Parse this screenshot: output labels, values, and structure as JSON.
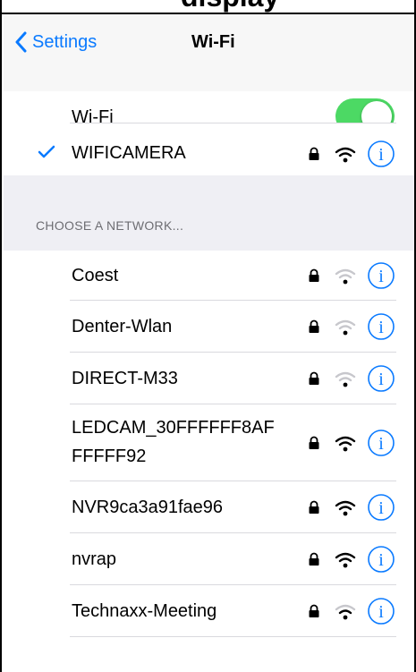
{
  "caption_fragment": "display",
  "nav": {
    "back_label": "Settings",
    "title": "Wi-Fi"
  },
  "wifi_toggle": {
    "label": "Wi-Fi",
    "on": true,
    "color": "#4cd964"
  },
  "connected": {
    "name": "WIFICAMERA",
    "check_color": "#0a7aff"
  },
  "section_header": "CHOOSE A NETWORK...",
  "networks": [
    {
      "name": "Coest",
      "signal": "weak"
    },
    {
      "name": "Denter-Wlan",
      "signal": "weak"
    },
    {
      "name": "DIRECT-M33",
      "signal": "weak"
    },
    {
      "name_line1": "LEDCAM_30FFFFFF8AF",
      "name_line2": "FFFFF92",
      "signal": "full"
    },
    {
      "name": "NVR9ca3a91fae96",
      "signal": "full"
    },
    {
      "name": "nvrap",
      "signal": "full"
    },
    {
      "name": "Technaxx-Meeting",
      "signal": "medium"
    }
  ],
  "icons": [
    "chevron-left-icon",
    "checkmark-icon",
    "lock-icon",
    "wifi-icon",
    "info-icon"
  ],
  "accent_color": "#0a7aff"
}
